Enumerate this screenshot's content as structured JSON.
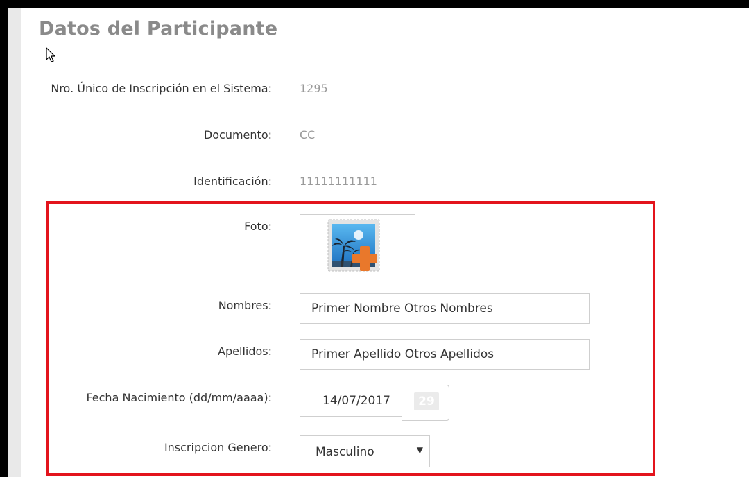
{
  "page": {
    "title": "Datos del Participante"
  },
  "fields": {
    "registration_label": "Nro. Único de Inscripción en el Sistema:",
    "registration_value": "1295",
    "document_label": "Documento:",
    "document_value": "CC",
    "identification_label": "Identificación:",
    "identification_value": "11111111111",
    "photo_label": "Foto:",
    "names_label": "Nombres:",
    "names_value": "Primer Nombre Otros Nombres",
    "surnames_label": "Apellidos:",
    "surnames_value": "Primer Apellido Otros Apellidos",
    "birthdate_label": "Fecha Nacimiento (dd/mm/aaaa):",
    "birthdate_value": "14/07/2017",
    "calendar_day": "29",
    "gender_label": "Inscripcion Genero:",
    "gender_value": "Masculino"
  },
  "colors": {
    "highlight_border": "#e3141c",
    "title": "#8a8a8a",
    "photo_orange": "#e9782b",
    "photo_blue": "#2a8fd8"
  },
  "icons": {
    "photo": "add-photo-icon",
    "calendar": "calendar-icon",
    "select": "dropdown-arrow-icon",
    "cursor": "mouse-pointer-icon"
  }
}
